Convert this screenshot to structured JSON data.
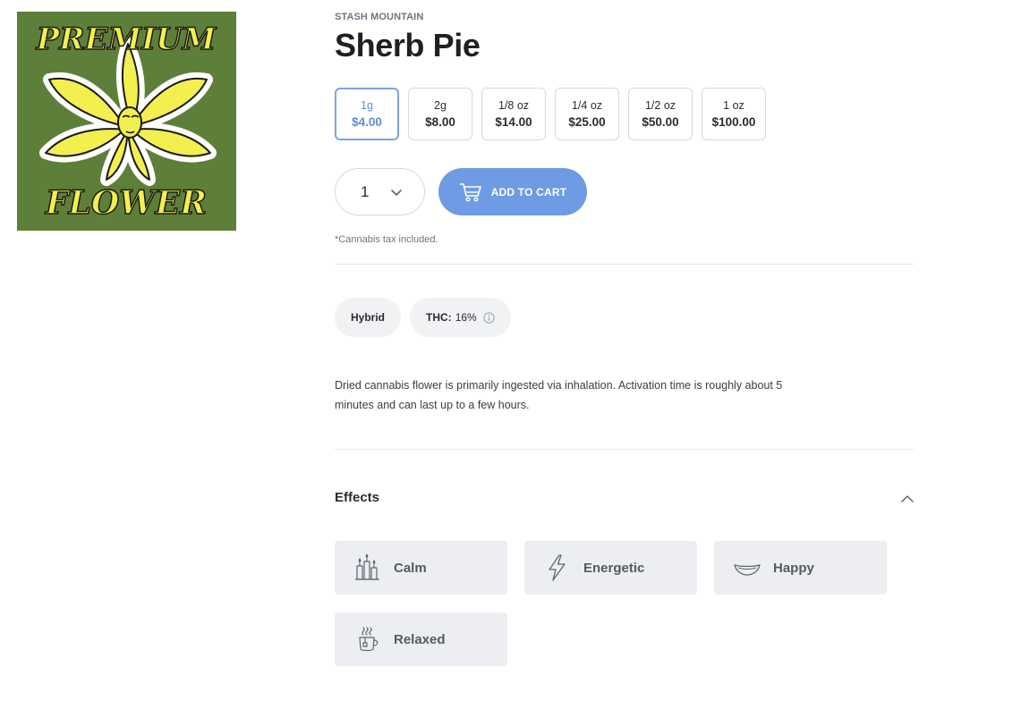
{
  "product_image": {
    "text_top": "PREMIUM",
    "text_bottom": "FLOWER",
    "colors": {
      "background": "#5e7f3a",
      "leaf": "#f3ef4f",
      "outline": "#1a1a1a"
    }
  },
  "brand": "STASH MOUNTAIN",
  "title": "Sherb Pie",
  "weights": [
    {
      "weight": "1g",
      "price": "$4.00",
      "selected": true
    },
    {
      "weight": "2g",
      "price": "$8.00",
      "selected": false
    },
    {
      "weight": "1/8 oz",
      "price": "$14.00",
      "selected": false
    },
    {
      "weight": "1/4 oz",
      "price": "$25.00",
      "selected": false
    },
    {
      "weight": "1/2 oz",
      "price": "$50.00",
      "selected": false
    },
    {
      "weight": "1 oz",
      "price": "$100.00",
      "selected": false
    }
  ],
  "quantity": {
    "value": "1",
    "icon": "chevron-down-icon"
  },
  "add_to_cart": {
    "label": "ADD TO CART",
    "icon": "cart-icon",
    "color": "#6f9ae4"
  },
  "tax_note": "*Cannabis tax included.",
  "tags": {
    "type": "Hybrid",
    "thc_label": "THC:",
    "thc_value": "16%",
    "info_icon": "info-icon"
  },
  "description": "Dried cannabis flower is primarily ingested via inhalation. Activation time is roughly about 5 minutes and can last up to a few hours.",
  "effects": {
    "title": "Effects",
    "toggle_icon": "chevron-up-icon",
    "items": [
      {
        "name": "Calm",
        "icon": "candles-icon"
      },
      {
        "name": "Energetic",
        "icon": "lightning-icon"
      },
      {
        "name": "Happy",
        "icon": "smile-icon"
      },
      {
        "name": "Relaxed",
        "icon": "tea-cup-icon"
      }
    ]
  },
  "colors": {
    "accent": "#6f9ae4",
    "selected_border": "#7ea3e6",
    "chip_bg": "#f1f2f4",
    "effect_bg": "#eceef1"
  }
}
